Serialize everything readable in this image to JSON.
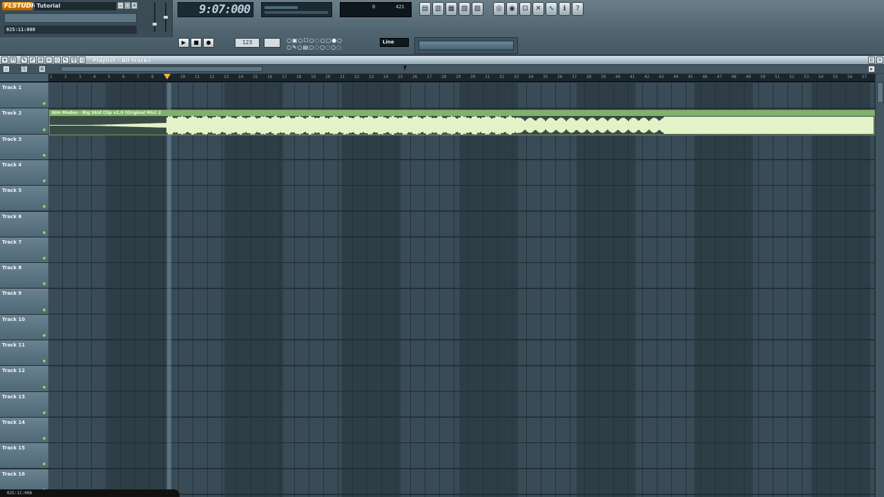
{
  "app": {
    "logo": "FLSTUDIO",
    "project_title": "Tutorial",
    "hint_text": "025:11:008"
  },
  "toolbar": {
    "time": "9:07:000",
    "poly": "0",
    "mem": "421",
    "pattern": "123",
    "snap": "Line",
    "preset": "",
    "transport": [
      "▶",
      "■",
      "●"
    ]
  },
  "playlist": {
    "title": "Playlist - All tracks",
    "corner_label": "",
    "clip_name": "Aim Modeo - Big Skid Clip v2.0 (Original Mix) 2",
    "tracks": [
      "Track 1",
      "Track 2",
      "Track 3",
      "Track 4",
      "Track 5",
      "Track 6",
      "Track 7",
      "Track 8",
      "Track 9",
      "Track 10",
      "Track 11",
      "Track 12",
      "Track 13",
      "Track 14",
      "Track 15",
      "Track 16"
    ],
    "ruler_ticks": [
      "1",
      "2",
      "3",
      "4",
      "5",
      "6",
      "7",
      "8",
      "9",
      "10",
      "11",
      "12",
      "13",
      "14",
      "15",
      "16",
      "17",
      "18",
      "19",
      "20",
      "21",
      "22",
      "23",
      "24",
      "25",
      "26",
      "27",
      "28",
      "29",
      "30",
      "31",
      "32",
      "33",
      "34",
      "35",
      "36",
      "37",
      "38",
      "39",
      "40",
      "41",
      "42",
      "43",
      "44",
      "45",
      "46",
      "47",
      "48",
      "49",
      "50",
      "51",
      "52",
      "53",
      "54",
      "55",
      "56",
      "57"
    ]
  },
  "status": {
    "overlay": "025:11:008"
  }
}
